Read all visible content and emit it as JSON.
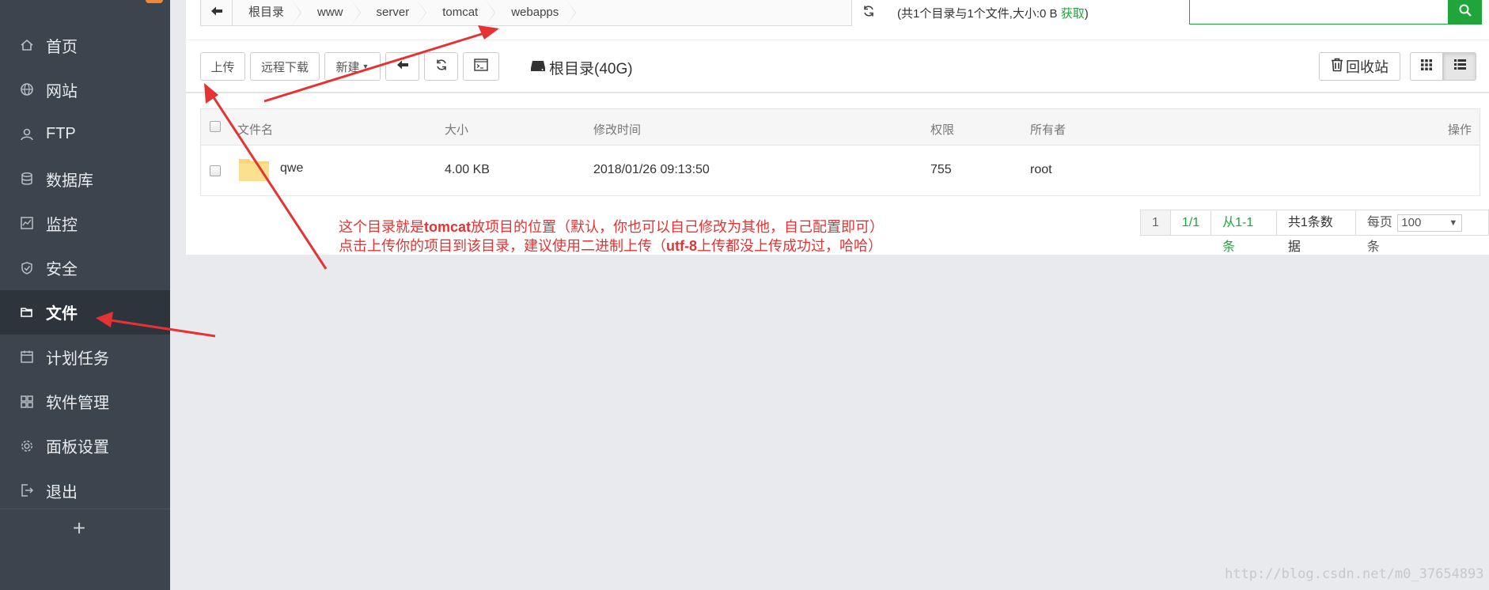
{
  "sidebar": {
    "items": [
      {
        "label": "首页",
        "icon": "home-icon",
        "active": false
      },
      {
        "label": "网站",
        "icon": "globe-icon",
        "active": false
      },
      {
        "label": "FTP",
        "icon": "ftp-icon",
        "active": false
      },
      {
        "label": "数据库",
        "icon": "database-icon",
        "active": false
      },
      {
        "label": "监控",
        "icon": "monitor-icon",
        "active": false
      },
      {
        "label": "安全",
        "icon": "shield-icon",
        "active": false
      },
      {
        "label": "文件",
        "icon": "folder-icon",
        "active": true
      },
      {
        "label": "计划任务",
        "icon": "calendar-icon",
        "active": false
      },
      {
        "label": "软件管理",
        "icon": "grid-icon",
        "active": false
      },
      {
        "label": "面板设置",
        "icon": "gear-icon",
        "active": false
      },
      {
        "label": "退出",
        "icon": "logout-icon",
        "active": false
      }
    ],
    "add_label": "+"
  },
  "breadcrumb": {
    "items": [
      "根目录",
      "www",
      "server",
      "tomcat",
      "webapps"
    ]
  },
  "dir_info": {
    "text": "(共1个目录与1个文件,大小:0 B ",
    "fetch": "获取",
    "close": ")"
  },
  "toolbar": {
    "upload": "上传",
    "remote_download": "远程下载",
    "new": "新建",
    "disk": "根目录(40G)",
    "recycle": "回收站"
  },
  "table": {
    "headers": {
      "name": "文件名",
      "size": "大小",
      "mtime": "修改时间",
      "perm": "权限",
      "owner": "所有者",
      "ops": "操作"
    },
    "rows": [
      {
        "name": "qwe",
        "size": "4.00 KB",
        "mtime": "2018/01/26 09:13:50",
        "perm": "755",
        "owner": "root"
      }
    ]
  },
  "note": {
    "line1_a": "这个目录就是",
    "line1_b": "tomcat",
    "line1_c": "放项目的位置（默认，你也可以自己修改为其他，自己配置即可）",
    "line2_a": "点击上传你的项目到该目录，建议使用二进制上传（",
    "line2_b": "utf-8",
    "line2_c": "上传都没上传成功过，哈哈）"
  },
  "pager": {
    "current": "1",
    "pages": "1/1",
    "range": "从1-1条",
    "total": "共1条数据",
    "per_page_label": "每页",
    "per_page": "100",
    "unit": "条"
  },
  "watermark": "http://blog.csdn.net/m0_37654893",
  "colors": {
    "sidebar_bg": "#3c444d",
    "accent_green": "#20a53a",
    "annotation_red": "#e53333"
  }
}
